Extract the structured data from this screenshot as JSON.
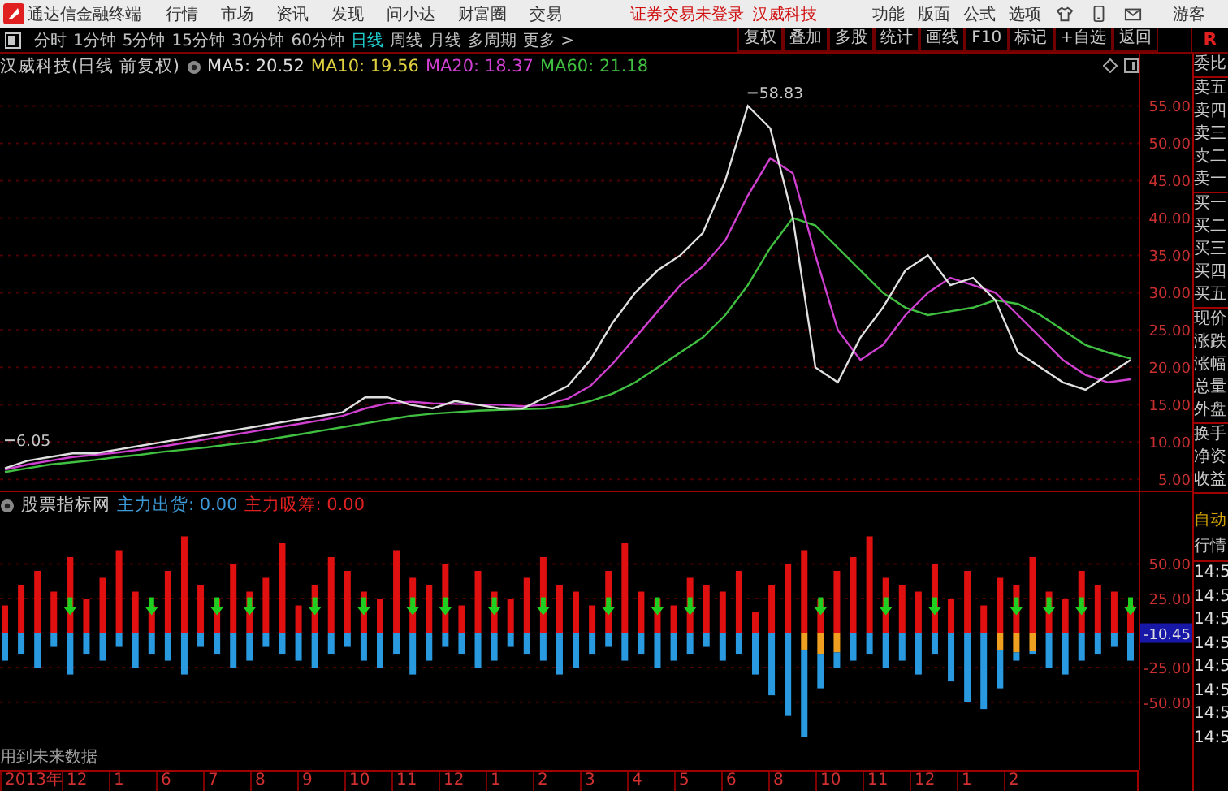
{
  "menubar": {
    "app_title": "通达信金融终端",
    "menus": [
      "行情",
      "市场",
      "资讯",
      "发现",
      "问小达",
      "财富圈",
      "交易"
    ],
    "login_status": "证券交易未登录",
    "stock_name": "汉威科技",
    "tools": [
      "功能",
      "版面",
      "公式",
      "选项"
    ],
    "user": "游客"
  },
  "period_tabs": [
    {
      "label": "分时",
      "selected": false
    },
    {
      "label": "1分钟",
      "selected": false
    },
    {
      "label": "5分钟",
      "selected": false
    },
    {
      "label": "15分钟",
      "selected": false
    },
    {
      "label": "30分钟",
      "selected": false
    },
    {
      "label": "60分钟",
      "selected": false
    },
    {
      "label": "日线",
      "selected": true
    },
    {
      "label": "周线",
      "selected": false
    },
    {
      "label": "月线",
      "selected": false
    },
    {
      "label": "多周期",
      "selected": false
    },
    {
      "label": "更多 >",
      "selected": false
    }
  ],
  "chart_buttons": [
    "复权",
    "叠加",
    "多股",
    "统计",
    "画线",
    "F10",
    "标记",
    "+自选",
    "返回"
  ],
  "corner_label": "R",
  "price_pane": {
    "title": "汉威科技(日线 前复权)",
    "ma_labels": [
      {
        "text": "MA5: 20.52",
        "color": "#e0e0e0"
      },
      {
        "text": "MA10: 19.56",
        "color": "#e0d040"
      },
      {
        "text": "MA20: 18.37",
        "color": "#d040d0"
      },
      {
        "text": "MA60: 21.18",
        "color": "#40c040"
      }
    ],
    "high_label": "58.83",
    "low_label": "6.05",
    "chart_data": {
      "type": "line",
      "grid": true,
      "ylim": [
        3.3,
        62
      ],
      "yticks": [
        {
          "value": 5,
          "label": "5.00"
        },
        {
          "value": 10,
          "label": "10.00"
        },
        {
          "value": 15,
          "label": "15.00"
        },
        {
          "value": 20,
          "label": "20.00"
        },
        {
          "value": 25,
          "label": "25.00"
        },
        {
          "value": 30,
          "label": "30.00"
        },
        {
          "value": 35,
          "label": "35.00"
        },
        {
          "value": 40,
          "label": "40.00"
        },
        {
          "value": 45,
          "label": "45.00"
        },
        {
          "value": 50,
          "label": "50.00"
        },
        {
          "value": 55,
          "label": "55.00"
        }
      ],
      "series": [
        {
          "color": "#40c040",
          "values": [
            6,
            6.5,
            7,
            7.3,
            7.6,
            8,
            8.3,
            8.7,
            9,
            9.3,
            9.7,
            10,
            10.5,
            11,
            11.5,
            12,
            12.5,
            13,
            13.5,
            13.8,
            14,
            14.2,
            14.3,
            14.4,
            14.5,
            14.8,
            15.5,
            16.5,
            18,
            20,
            22,
            24,
            27,
            31,
            36,
            40,
            39,
            36,
            33,
            30,
            28,
            27,
            27.5,
            28,
            29,
            28.5,
            27,
            25,
            23,
            22,
            21.2
          ]
        },
        {
          "color": "#d040d0",
          "values": [
            6.3,
            7,
            7.5,
            8,
            8.3,
            8.6,
            9,
            9.4,
            9.9,
            10.4,
            10.9,
            11.4,
            11.9,
            12.4,
            12.9,
            13.5,
            14.5,
            15.2,
            15.4,
            15.2,
            15.1,
            15,
            15,
            14.8,
            15,
            15.8,
            17.5,
            20.5,
            24,
            27.5,
            31,
            33.5,
            37,
            43,
            48,
            46,
            35,
            25,
            21,
            23,
            27,
            30,
            32,
            31,
            30,
            27,
            24,
            21,
            19,
            18,
            18.4
          ]
        },
        {
          "color": "#e0e0e0",
          "values": [
            6.5,
            7.5,
            8,
            8.5,
            8.5,
            9,
            9.5,
            10,
            10.5,
            11,
            11.5,
            12,
            12.5,
            13,
            13.5,
            14,
            16,
            16,
            15,
            14.5,
            15.5,
            15,
            14.5,
            14.5,
            16,
            17.5,
            21,
            26,
            30,
            33,
            35,
            38,
            45,
            55,
            52,
            40,
            20,
            18,
            24,
            28,
            33,
            35,
            31,
            32,
            29,
            22,
            20,
            18,
            17,
            19,
            21
          ]
        }
      ]
    }
  },
  "indicator_pane": {
    "title": "股票指标网",
    "legends": [
      {
        "text": "主力出货: 0.00",
        "color": "#3c9ad8"
      },
      {
        "text": "主力吸筹: 0.00",
        "color": "#e02020"
      }
    ],
    "current_value": "-10.45",
    "warning": "用到未来数据",
    "chart_data": {
      "type": "bar",
      "stacked": true,
      "grid": true,
      "ylim": [
        -99,
        102
      ],
      "yticks": [
        {
          "value": 50,
          "label": "50.00"
        },
        {
          "value": 25,
          "label": "25.00"
        },
        {
          "value": -25,
          "label": "-25.00"
        },
        {
          "value": -50,
          "label": "-50.00"
        }
      ],
      "series": [
        {
          "color": "#e01010",
          "values": [
            20,
            35,
            45,
            30,
            55,
            25,
            40,
            60,
            30,
            20,
            45,
            70,
            35,
            25,
            50,
            30,
            40,
            65,
            20,
            35,
            55,
            45,
            30,
            25,
            60,
            40,
            35,
            50,
            20,
            45,
            30,
            25,
            40,
            55,
            35,
            30,
            20,
            45,
            65,
            30,
            25,
            20,
            40,
            35,
            30,
            45,
            15,
            35,
            50,
            60,
            25,
            45,
            55,
            70,
            40,
            35,
            30,
            50,
            25,
            45,
            20,
            40,
            35,
            55,
            30,
            25,
            45,
            35,
            30,
            20
          ]
        },
        {
          "color": "#f0a020",
          "values": [
            null,
            null,
            null,
            null,
            null,
            null,
            null,
            null,
            null,
            null,
            null,
            null,
            null,
            null,
            null,
            null,
            null,
            null,
            null,
            null,
            null,
            null,
            null,
            null,
            null,
            null,
            null,
            null,
            null,
            null,
            null,
            null,
            null,
            null,
            null,
            null,
            null,
            null,
            null,
            null,
            null,
            null,
            null,
            null,
            null,
            null,
            null,
            null,
            null,
            -12,
            -15,
            -14,
            null,
            null,
            null,
            null,
            null,
            null,
            null,
            null,
            null,
            -12,
            -14,
            -13,
            null,
            null,
            null,
            null,
            null,
            null
          ]
        },
        {
          "color": "#2a9ae0",
          "values": [
            -20,
            -15,
            -25,
            -10,
            -30,
            -15,
            -20,
            -10,
            -25,
            -15,
            -20,
            -30,
            -10,
            -15,
            -25,
            -20,
            -10,
            -15,
            -20,
            -25,
            -15,
            -10,
            -20,
            -25,
            -15,
            -30,
            -20,
            -10,
            -15,
            -25,
            -20,
            -10,
            -15,
            -20,
            -30,
            -25,
            -15,
            -10,
            -20,
            -15,
            -25,
            -20,
            -15,
            -10,
            -20,
            -15,
            -30,
            -45,
            -60,
            -63,
            -25,
            -11,
            -20,
            -15,
            -25,
            -20,
            -30,
            -15,
            -35,
            -50,
            -55,
            -28,
            -6,
            -2,
            -25,
            -30,
            -20,
            -15,
            -10,
            -20
          ]
        },
        {
          "type": "scatter",
          "color": "#20d020",
          "values": [
            null,
            null,
            null,
            null,
            20,
            null,
            null,
            null,
            null,
            20,
            null,
            null,
            null,
            20,
            null,
            20,
            null,
            null,
            null,
            20,
            null,
            null,
            20,
            null,
            null,
            20,
            null,
            20,
            null,
            null,
            20,
            null,
            null,
            20,
            null,
            null,
            null,
            20,
            null,
            null,
            20,
            null,
            20,
            null,
            null,
            null,
            null,
            null,
            null,
            null,
            20,
            null,
            null,
            null,
            20,
            null,
            null,
            20,
            null,
            null,
            null,
            null,
            20,
            null,
            20,
            null,
            20,
            null,
            null,
            20
          ]
        }
      ]
    }
  },
  "date_axis": [
    "2013年",
    "12",
    "1",
    "6",
    "7",
    "8",
    "9",
    "10",
    "11",
    "12",
    "1",
    "2",
    "3",
    "4",
    "5",
    "6",
    "8",
    "10",
    "11",
    "12",
    "1",
    "2"
  ],
  "quote_panel": {
    "groups": [
      [
        "委比"
      ],
      [
        "卖五",
        "卖四",
        "卖三",
        "卖二",
        "卖一"
      ],
      [
        "买一",
        "买二",
        "买三",
        "买四",
        "买五"
      ],
      [
        "现价",
        "涨跌",
        "涨幅",
        "总量",
        "外盘"
      ],
      [
        "换手",
        "净资",
        "收益"
      ]
    ],
    "mode": "自动",
    "section": "行情",
    "times": [
      "14:5",
      "14:5",
      "14:5",
      "14:5",
      "14:5",
      "14:5",
      "14:5",
      "14:5"
    ]
  }
}
